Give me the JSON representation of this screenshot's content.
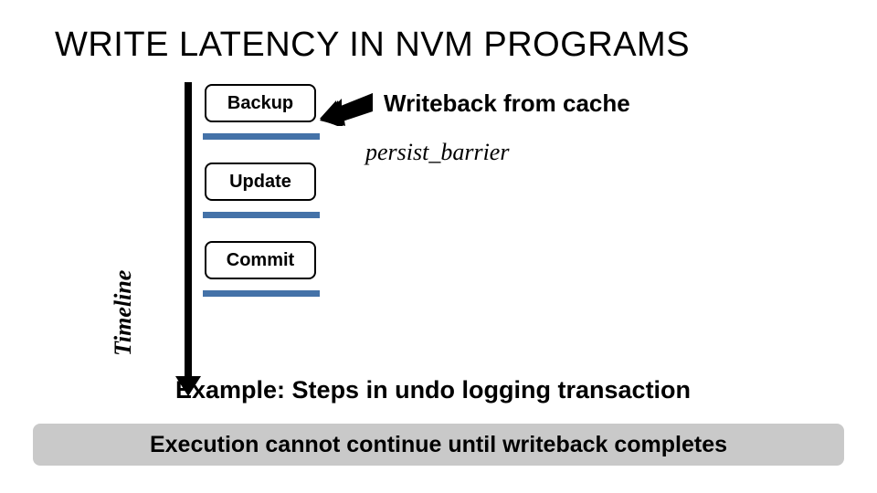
{
  "title": "WRITE LATENCY IN NVM PROGRAMS",
  "timeline": {
    "axis_label": "Timeline",
    "stages": {
      "backup": "Backup",
      "update": "Update",
      "commit": "Commit"
    }
  },
  "annotations": {
    "writeback": "Writeback from cache",
    "persist_barrier": "persist_barrier"
  },
  "example_caption": "Example: Steps in undo logging transaction",
  "banner": "Execution cannot continue until writeback completes",
  "colors": {
    "separator": "#4472a8",
    "banner_bg": "#c9c9c9"
  }
}
